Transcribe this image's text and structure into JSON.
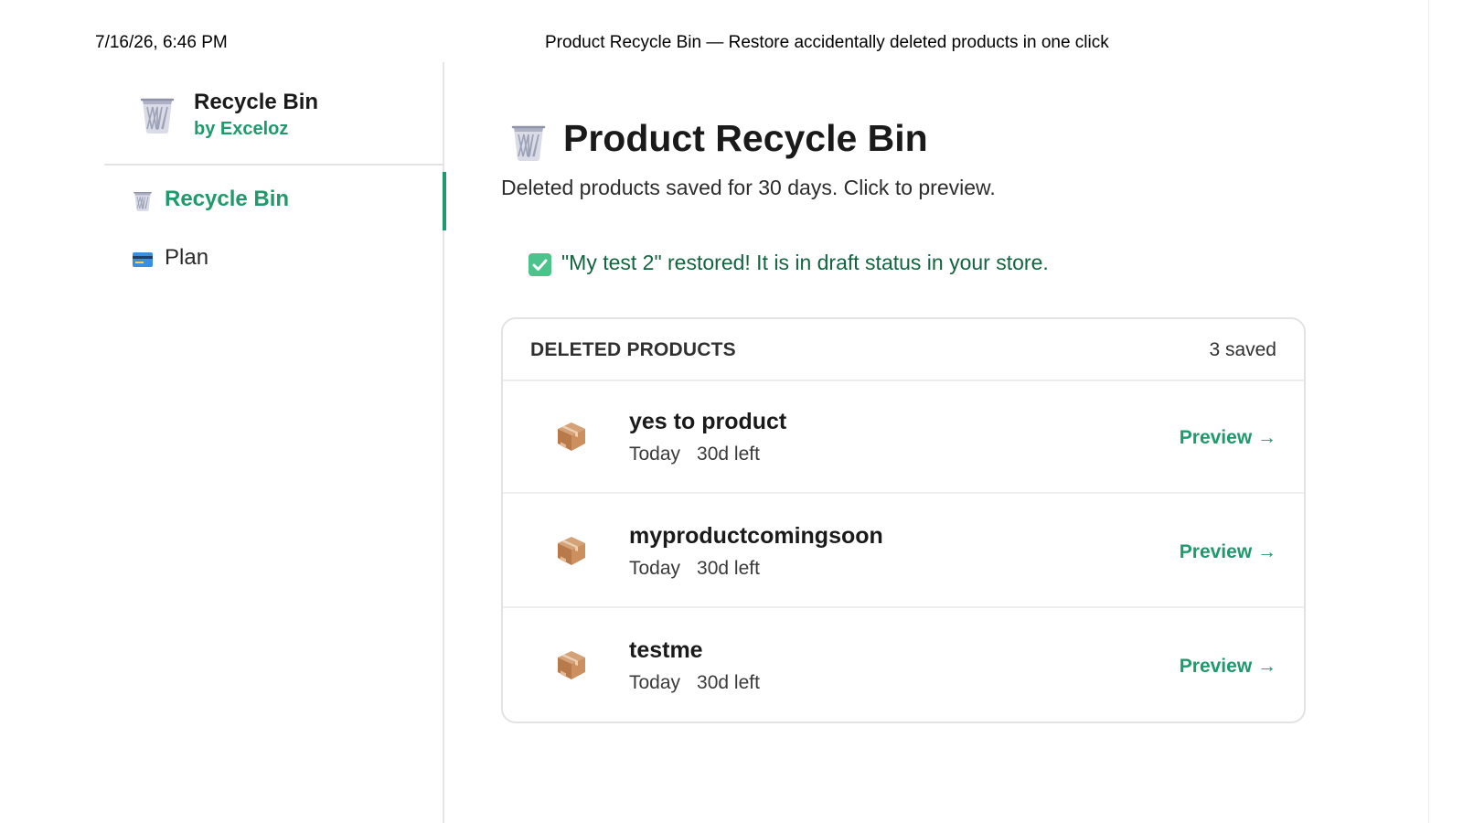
{
  "print_header": {
    "datetime": "7/16/26, 6:46 PM",
    "page_title": "Product Recycle Bin — Restore accidentally deleted products in one click"
  },
  "sidebar": {
    "app_name": "Recycle Bin",
    "app_by": "by Exceloz",
    "app_icon": "wastebasket-icon",
    "items": [
      {
        "label": "Recycle Bin",
        "icon": "wastebasket-icon",
        "active": true
      },
      {
        "label": "Plan",
        "icon": "credit-card-icon",
        "active": false
      }
    ]
  },
  "main": {
    "title": "Product Recycle Bin",
    "title_icon": "wastebasket-icon",
    "subtitle": "Deleted products saved for 30 days. Click to preview.",
    "toast": "\"My test 2\" restored! It is in draft status in your store.",
    "toast_icon": "check-mark-icon",
    "card": {
      "heading": "DELETED PRODUCTS",
      "count": "3 saved",
      "rows": [
        {
          "name": "yes to product",
          "date": "Today",
          "remaining": "30d left",
          "action": "Preview →",
          "icon": "package-icon"
        },
        {
          "name": "myproductcomingsoon",
          "date": "Today",
          "remaining": "30d left",
          "action": "Preview →",
          "icon": "package-icon"
        },
        {
          "name": "testme",
          "date": "Today",
          "remaining": "30d left",
          "action": "Preview →",
          "icon": "package-icon"
        }
      ]
    }
  },
  "colors": {
    "accent": "#1f9a6c",
    "toast_text": "#13643f",
    "check_bg": "#4cc38a"
  }
}
